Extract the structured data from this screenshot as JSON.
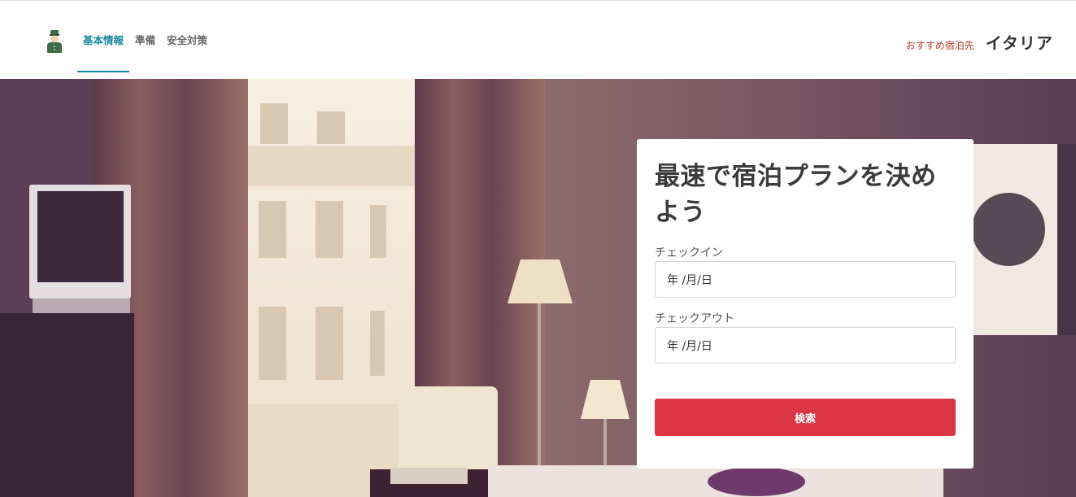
{
  "header": {
    "nav": [
      {
        "label": "基本情報",
        "active": true
      },
      {
        "label": "準備",
        "active": false
      },
      {
        "label": "安全対策",
        "active": false
      }
    ],
    "recommend_label": "おすすめ宿泊先",
    "destination": "イタリア"
  },
  "search": {
    "title": "最速で宿泊プランを決めよう",
    "checkin_label": "チェックイン",
    "checkin_value": "年 /月/日",
    "checkout_label": "チェックアウト",
    "checkout_value": "年 /月/日",
    "button_label": "検索"
  },
  "colors": {
    "accent": "#17899c",
    "button": "#dc3545",
    "recommend": "#c0392b"
  }
}
